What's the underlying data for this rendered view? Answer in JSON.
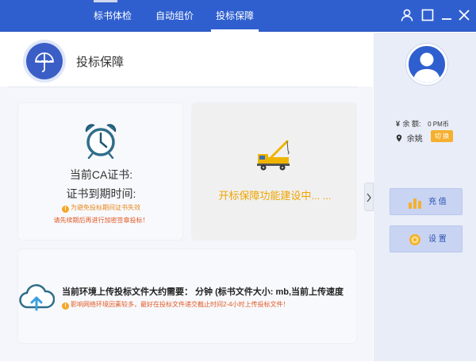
{
  "top_tabs": [
    {
      "label": "标书体检",
      "active": false
    },
    {
      "label": "自动组价",
      "active": false
    },
    {
      "label": "投标保障",
      "active": true
    }
  ],
  "window_controls": [
    "user-icon",
    "maximize-icon",
    "minimize-icon",
    "close-icon"
  ],
  "page": {
    "title": "投标保障",
    "icon": "umbrella-icon"
  },
  "ca_card": {
    "icon": "alarm-clock-icon",
    "title": "当前CA证书:",
    "expire_label": "证书到期时间:",
    "warning_line1": "为避免投标期间证书失效",
    "warning_line2": "请先续期后再进行加密签章投标！"
  },
  "open_card": {
    "icon": "crane-truck-icon",
    "text": "开标保障功能建设中... ..."
  },
  "upload_card": {
    "icon": "cloud-upload-icon",
    "line": "当前环境上传投标文件大约需要： 分钟 (标书文件大小:  mb,当前上传速度",
    "warning": "影响网络环境因素较多，最好在投标文件递交截止时间2-4小时上传投标文件！"
  },
  "sidebar": {
    "avatar": "user-avatar-icon",
    "balance_symbol": "¥",
    "balance_label": "余 额:",
    "balance_value": "0 PM币",
    "username": "余姚",
    "switch_label": "切 换",
    "recharge_label": "充 值",
    "settings_label": "设 置"
  },
  "colors": {
    "primary": "#2f5fcf",
    "accent_orange": "#f0a500",
    "warning_red": "#e25a26",
    "sidebar_bg": "#e9edf7"
  }
}
